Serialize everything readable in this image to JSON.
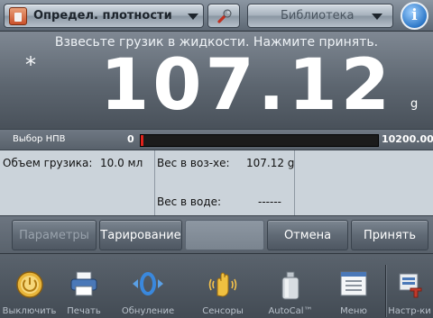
{
  "toolbar": {
    "mode_label": "Определ. плотности",
    "library_label": "Библиотека",
    "info_label": "i"
  },
  "display": {
    "instruction": "Взвесьте грузик в жидкости. Нажмите принять.",
    "stable_marker": "*",
    "weight_value": "107.12",
    "unit": "g"
  },
  "capacity": {
    "label": "Выбор НПВ",
    "min": "0",
    "max": "10200.00",
    "fill_fraction": 0.0105
  },
  "grid": {
    "volume_label": "Объем грузика:",
    "volume_value": "10.0 мл",
    "weight_air_label": "Вес в воз-хе:",
    "weight_air_value": "107.12 g",
    "weight_water_label": "Вес в воде:",
    "weight_water_value": "------"
  },
  "softkeys": {
    "params": "Параметры",
    "tare": "Тарирование",
    "cancel": "Отмена",
    "accept": "Принять"
  },
  "nav": [
    {
      "label": "Выключить",
      "icon": "power-icon"
    },
    {
      "label": "Печать",
      "icon": "printer-icon"
    },
    {
      "label": "Обнуление",
      "icon": "zero-icon"
    },
    {
      "label": "Сенсоры",
      "icon": "hand-sensor-icon"
    },
    {
      "label": "AutoCal™",
      "icon": "calibration-weight-icon"
    },
    {
      "label": "Меню",
      "icon": "menu-icon"
    },
    {
      "label": "Настр-ки",
      "icon": "settings-icon"
    }
  ],
  "colors": {
    "capacity_fill": "#e0221c",
    "info_button": "#2d78c8"
  }
}
